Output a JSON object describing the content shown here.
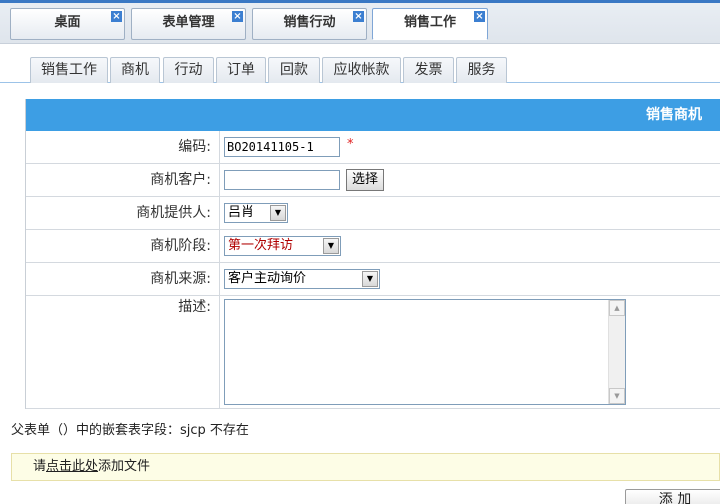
{
  "window_tabs": [
    {
      "label": "桌面",
      "close": "×"
    },
    {
      "label": "表单管理",
      "close": "×"
    },
    {
      "label": "销售行动",
      "close": "×"
    },
    {
      "label": "销售工作",
      "close": "×",
      "active": true
    }
  ],
  "module_tabs": [
    "销售工作",
    "商机",
    "行动",
    "订单",
    "回款",
    "应收帐款",
    "发票",
    "服务"
  ],
  "form": {
    "header": "销售商机",
    "code_label": "编码:",
    "code_value": "BO20141105-1",
    "required_mark": "*",
    "customer_label": "商机客户:",
    "customer_value": "",
    "choose_button": "选择",
    "provider_label": "商机提供人:",
    "provider_value": "吕肖",
    "stage_label": "商机阶段:",
    "stage_value": "第一次拜访",
    "source_label": "商机来源:",
    "source_value": "客户主动询价",
    "desc_label": "描述:",
    "desc_value": ""
  },
  "note": "父表单（）中的嵌套表字段：sjcp 不存在",
  "attach": {
    "prefix": "请",
    "link": "点击此处",
    "suffix": "添加文件"
  },
  "add_button": "添 加",
  "icons": {
    "close": "close-icon",
    "dropdown": "chevron-down-icon"
  },
  "colors": {
    "header_bg": "#3d9ee4",
    "required": "#e02020",
    "stage_text": "#b00000",
    "tab_close": "#3c7fd1"
  }
}
